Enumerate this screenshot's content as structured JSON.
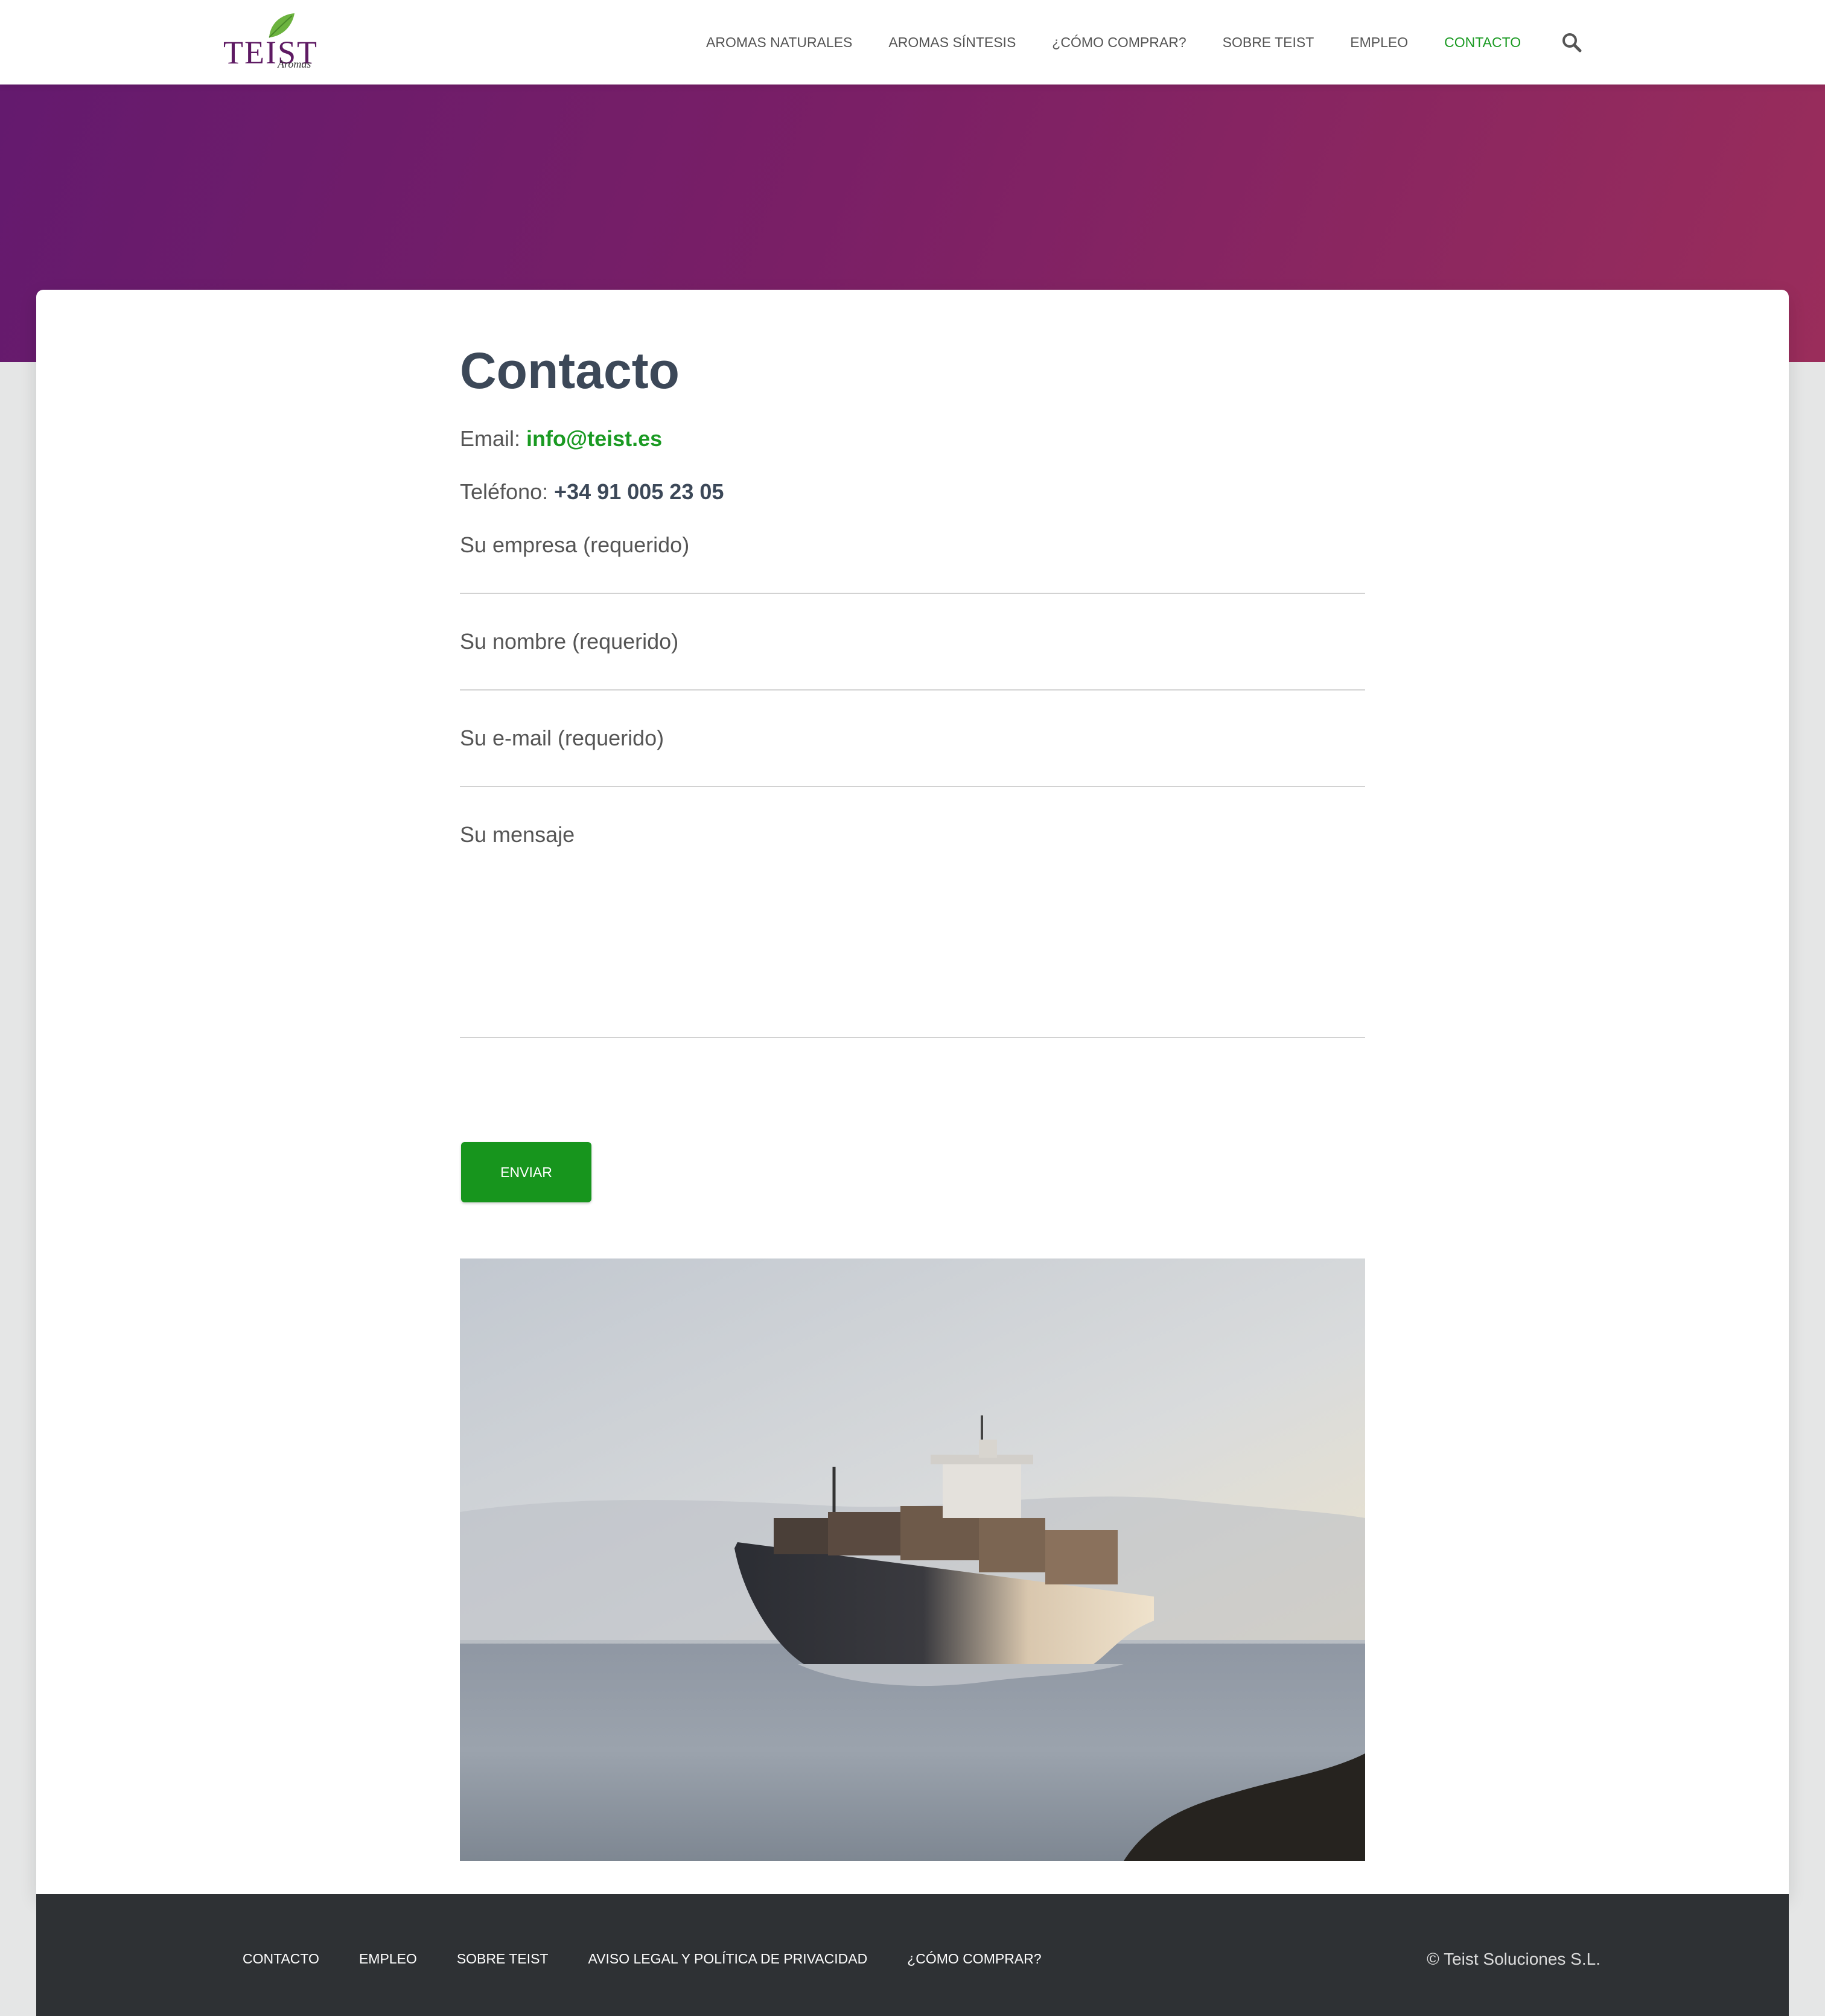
{
  "brand": {
    "name": "TEIST",
    "tagline": "Aromas"
  },
  "nav": {
    "items": [
      {
        "label": "AROMAS NATURALES",
        "active": false
      },
      {
        "label": "AROMAS SÍNTESIS",
        "active": false
      },
      {
        "label": "¿CÓMO COMPRAR?",
        "active": false
      },
      {
        "label": "SOBRE TEIST",
        "active": false
      },
      {
        "label": "EMPLEO",
        "active": false
      },
      {
        "label": "CONTACTO",
        "active": true
      }
    ],
    "search_icon": "search-icon"
  },
  "page": {
    "title": "Contacto",
    "email_label": "Email:",
    "email_value": "info@teist.es",
    "phone_label": "Teléfono:",
    "phone_value": "+34 91 005 23 05"
  },
  "form": {
    "company_label": "Su empresa (requerido)",
    "name_label": "Su nombre (requerido)",
    "email_label": "Su e-mail (requerido)",
    "message_label": "Su mensaje",
    "submit_label": "ENVIAR"
  },
  "footer": {
    "links": [
      "CONTACTO",
      "EMPLEO",
      "SOBRE TEIST",
      "AVISO LEGAL Y POLÍTICA DE PRIVACIDAD",
      "¿CÓMO COMPRAR?"
    ],
    "copyright": "© Teist Soluciones S.L."
  },
  "colors": {
    "accent_green": "#1a9a22",
    "hero_purple": "#641a6e",
    "hero_magenta": "#9a2d5b",
    "footer_bg": "#2e3134",
    "text_dark": "#3c4858"
  }
}
